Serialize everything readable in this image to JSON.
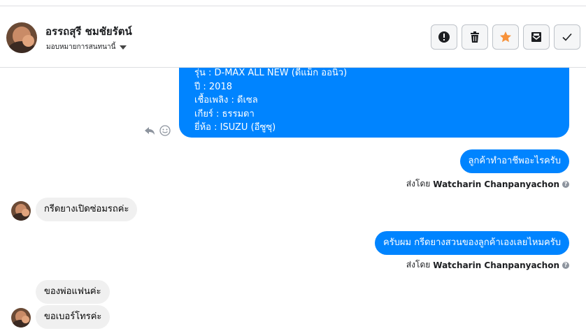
{
  "header": {
    "contact_name": "อรรถสุรี ชมชัยรัตน์",
    "assign_label": "มอบหมายการสนทนานี้",
    "actions": [
      {
        "name": "report-button",
        "icon": "alert-icon"
      },
      {
        "name": "delete-button",
        "icon": "trash-icon"
      },
      {
        "name": "star-button",
        "icon": "star-icon",
        "color": "#f7923b"
      },
      {
        "name": "mark-unread-button",
        "icon": "envelope-icon"
      },
      {
        "name": "mark-done-button",
        "icon": "check-icon"
      }
    ]
  },
  "messages": {
    "car_details": {
      "model": "รุ่น : D-MAX ALL NEW (ดีแม็ก ออนิว)",
      "year": "ปี : 2018",
      "fuel": "เชื้อเพลิง : ดีเซล",
      "gear": "เกียร์ : ธรรมดา",
      "brand": "ยี่ห้อ : ISUZU (อีซูซุ)"
    },
    "msg1": "ลูกค้าทำอาชีพอะไรครับ",
    "sent_by_prefix": "ส่งโดย",
    "agent": "Watcharin Chanpanyachon",
    "msg2": "กรีดยางเปิดซ่อมรถค่ะ",
    "msg3": "ครับผม กรีดยางสวนของลูกค้าเองเลยไหมครับ",
    "msg4": "ของพ่อแฟนค่ะ",
    "msg5": "ขอเบอร์โทรค่ะ",
    "help_glyph": "?"
  },
  "colors": {
    "accent": "#0084ff",
    "incoming": "#f0f0f0",
    "star": "#f7923b"
  }
}
